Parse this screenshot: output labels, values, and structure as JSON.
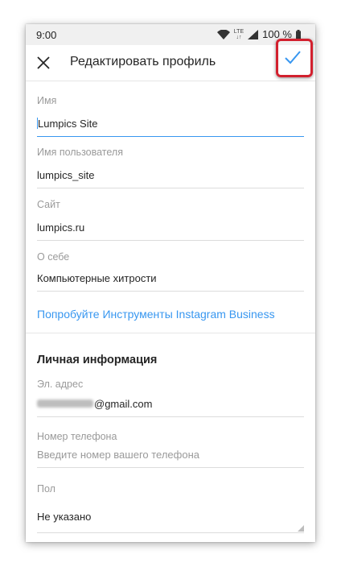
{
  "status_bar": {
    "time": "9:00",
    "network": "LTE",
    "battery": "100 %"
  },
  "app_bar": {
    "title": "Редактировать профиль",
    "close_icon": "close-icon",
    "confirm_icon": "check-icon"
  },
  "fields": {
    "name": {
      "label": "Имя",
      "value": "Lumpics Site"
    },
    "username": {
      "label": "Имя пользователя",
      "value": "lumpics_site"
    },
    "website": {
      "label": "Сайт",
      "value": "lumpics.ru"
    },
    "bio": {
      "label": "О себе",
      "value": "Компьютерные хитрости"
    }
  },
  "business_link": "Попробуйте Инструменты Instagram Business",
  "private_section": {
    "title": "Личная информация",
    "email": {
      "label": "Эл. адрес",
      "value_visible_part": "@gmail.com"
    },
    "phone": {
      "label": "Номер телефона",
      "placeholder": "Введите номер вашего телефона"
    },
    "gender": {
      "label": "Пол",
      "value": "Не указано"
    }
  },
  "colors": {
    "accent": "#3897f0",
    "highlight_border": "#d2202e"
  }
}
